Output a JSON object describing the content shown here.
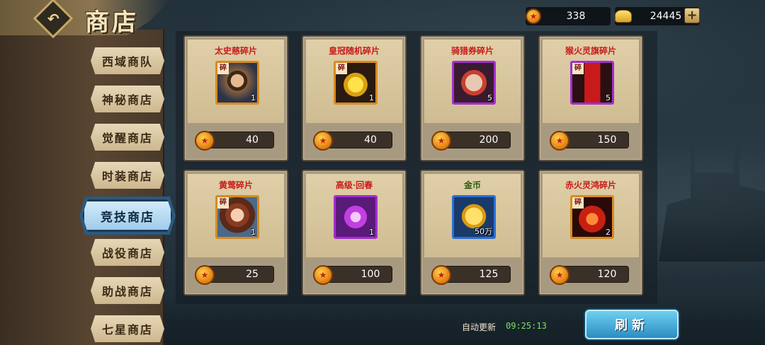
{
  "header": {
    "title": "商店",
    "coins": "338",
    "gold": "24445",
    "plus_label": "+"
  },
  "tabs": [
    {
      "label": "西域商队",
      "active": false
    },
    {
      "label": "神秘商店",
      "active": false
    },
    {
      "label": "觉醒商店",
      "active": false
    },
    {
      "label": "时装商店",
      "active": false
    },
    {
      "label": "竞技商店",
      "active": true
    },
    {
      "label": "战役商店",
      "active": false
    },
    {
      "label": "助战商店",
      "active": false
    },
    {
      "label": "七星商店",
      "active": false
    }
  ],
  "items": [
    {
      "name": "太史慈碎片",
      "qty": "1",
      "price": "40",
      "frame": "orange",
      "fragment": true
    },
    {
      "name": "皇冠随机碎片",
      "qty": "1",
      "price": "40",
      "frame": "orange",
      "fragment": true
    },
    {
      "name": "骑猎券碎片",
      "qty": "5",
      "price": "200",
      "frame": "purple",
      "fragment": false
    },
    {
      "name": "猴火灵旗碎片",
      "qty": "5",
      "price": "150",
      "frame": "purple",
      "fragment": true
    },
    {
      "name": "黄莺碎片",
      "qty": "1",
      "price": "25",
      "frame": "orange",
      "fragment": true
    },
    {
      "name": "高级·回春",
      "qty": "1",
      "price": "100",
      "frame": "purple",
      "fragment": false
    },
    {
      "name": "金币",
      "qty": "50万",
      "price": "125",
      "frame": "blue",
      "fragment": false
    },
    {
      "name": "赤火灵鸿碎片",
      "qty": "2",
      "price": "120",
      "frame": "orange",
      "fragment": true
    }
  ],
  "fragment_tag": "碎",
  "footer": {
    "auto_refresh_label": "自动更新",
    "auto_refresh_time": "09:25:13",
    "refresh_button": "刷新"
  },
  "colors": {
    "item_name_red": "#c81a1a",
    "item_name_green": "#2c5a12",
    "timer_green": "#7ce060",
    "refresh_blue": "#2a8cc2"
  }
}
